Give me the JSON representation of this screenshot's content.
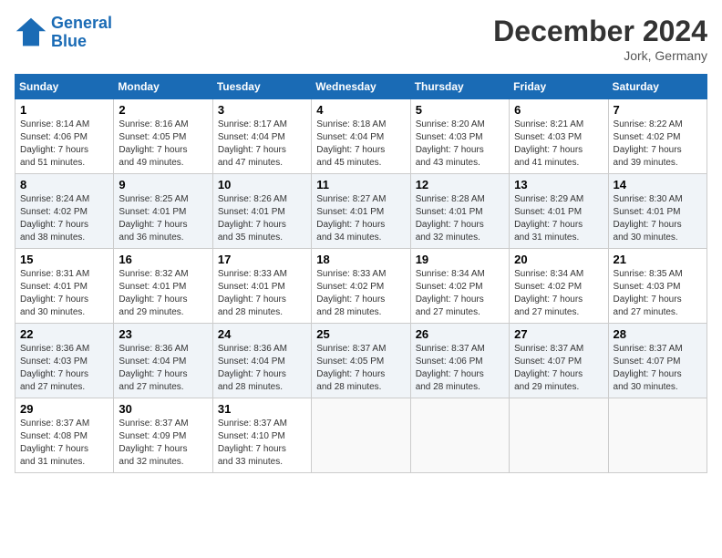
{
  "logo": {
    "line1": "General",
    "line2": "Blue"
  },
  "title": "December 2024",
  "location": "Jork, Germany",
  "days_of_week": [
    "Sunday",
    "Monday",
    "Tuesday",
    "Wednesday",
    "Thursday",
    "Friday",
    "Saturday"
  ],
  "weeks": [
    [
      {
        "day": "1",
        "text": "Sunrise: 8:14 AM\nSunset: 4:06 PM\nDaylight: 7 hours\nand 51 minutes."
      },
      {
        "day": "2",
        "text": "Sunrise: 8:16 AM\nSunset: 4:05 PM\nDaylight: 7 hours\nand 49 minutes."
      },
      {
        "day": "3",
        "text": "Sunrise: 8:17 AM\nSunset: 4:04 PM\nDaylight: 7 hours\nand 47 minutes."
      },
      {
        "day": "4",
        "text": "Sunrise: 8:18 AM\nSunset: 4:04 PM\nDaylight: 7 hours\nand 45 minutes."
      },
      {
        "day": "5",
        "text": "Sunrise: 8:20 AM\nSunset: 4:03 PM\nDaylight: 7 hours\nand 43 minutes."
      },
      {
        "day": "6",
        "text": "Sunrise: 8:21 AM\nSunset: 4:03 PM\nDaylight: 7 hours\nand 41 minutes."
      },
      {
        "day": "7",
        "text": "Sunrise: 8:22 AM\nSunset: 4:02 PM\nDaylight: 7 hours\nand 39 minutes."
      }
    ],
    [
      {
        "day": "8",
        "text": "Sunrise: 8:24 AM\nSunset: 4:02 PM\nDaylight: 7 hours\nand 38 minutes."
      },
      {
        "day": "9",
        "text": "Sunrise: 8:25 AM\nSunset: 4:01 PM\nDaylight: 7 hours\nand 36 minutes."
      },
      {
        "day": "10",
        "text": "Sunrise: 8:26 AM\nSunset: 4:01 PM\nDaylight: 7 hours\nand 35 minutes."
      },
      {
        "day": "11",
        "text": "Sunrise: 8:27 AM\nSunset: 4:01 PM\nDaylight: 7 hours\nand 34 minutes."
      },
      {
        "day": "12",
        "text": "Sunrise: 8:28 AM\nSunset: 4:01 PM\nDaylight: 7 hours\nand 32 minutes."
      },
      {
        "day": "13",
        "text": "Sunrise: 8:29 AM\nSunset: 4:01 PM\nDaylight: 7 hours\nand 31 minutes."
      },
      {
        "day": "14",
        "text": "Sunrise: 8:30 AM\nSunset: 4:01 PM\nDaylight: 7 hours\nand 30 minutes."
      }
    ],
    [
      {
        "day": "15",
        "text": "Sunrise: 8:31 AM\nSunset: 4:01 PM\nDaylight: 7 hours\nand 30 minutes."
      },
      {
        "day": "16",
        "text": "Sunrise: 8:32 AM\nSunset: 4:01 PM\nDaylight: 7 hours\nand 29 minutes."
      },
      {
        "day": "17",
        "text": "Sunrise: 8:33 AM\nSunset: 4:01 PM\nDaylight: 7 hours\nand 28 minutes."
      },
      {
        "day": "18",
        "text": "Sunrise: 8:33 AM\nSunset: 4:02 PM\nDaylight: 7 hours\nand 28 minutes."
      },
      {
        "day": "19",
        "text": "Sunrise: 8:34 AM\nSunset: 4:02 PM\nDaylight: 7 hours\nand 27 minutes."
      },
      {
        "day": "20",
        "text": "Sunrise: 8:34 AM\nSunset: 4:02 PM\nDaylight: 7 hours\nand 27 minutes."
      },
      {
        "day": "21",
        "text": "Sunrise: 8:35 AM\nSunset: 4:03 PM\nDaylight: 7 hours\nand 27 minutes."
      }
    ],
    [
      {
        "day": "22",
        "text": "Sunrise: 8:36 AM\nSunset: 4:03 PM\nDaylight: 7 hours\nand 27 minutes."
      },
      {
        "day": "23",
        "text": "Sunrise: 8:36 AM\nSunset: 4:04 PM\nDaylight: 7 hours\nand 27 minutes."
      },
      {
        "day": "24",
        "text": "Sunrise: 8:36 AM\nSunset: 4:04 PM\nDaylight: 7 hours\nand 28 minutes."
      },
      {
        "day": "25",
        "text": "Sunrise: 8:37 AM\nSunset: 4:05 PM\nDaylight: 7 hours\nand 28 minutes."
      },
      {
        "day": "26",
        "text": "Sunrise: 8:37 AM\nSunset: 4:06 PM\nDaylight: 7 hours\nand 28 minutes."
      },
      {
        "day": "27",
        "text": "Sunrise: 8:37 AM\nSunset: 4:07 PM\nDaylight: 7 hours\nand 29 minutes."
      },
      {
        "day": "28",
        "text": "Sunrise: 8:37 AM\nSunset: 4:07 PM\nDaylight: 7 hours\nand 30 minutes."
      }
    ],
    [
      {
        "day": "29",
        "text": "Sunrise: 8:37 AM\nSunset: 4:08 PM\nDaylight: 7 hours\nand 31 minutes."
      },
      {
        "day": "30",
        "text": "Sunrise: 8:37 AM\nSunset: 4:09 PM\nDaylight: 7 hours\nand 32 minutes."
      },
      {
        "day": "31",
        "text": "Sunrise: 8:37 AM\nSunset: 4:10 PM\nDaylight: 7 hours\nand 33 minutes."
      },
      {
        "day": "",
        "text": ""
      },
      {
        "day": "",
        "text": ""
      },
      {
        "day": "",
        "text": ""
      },
      {
        "day": "",
        "text": ""
      }
    ]
  ]
}
